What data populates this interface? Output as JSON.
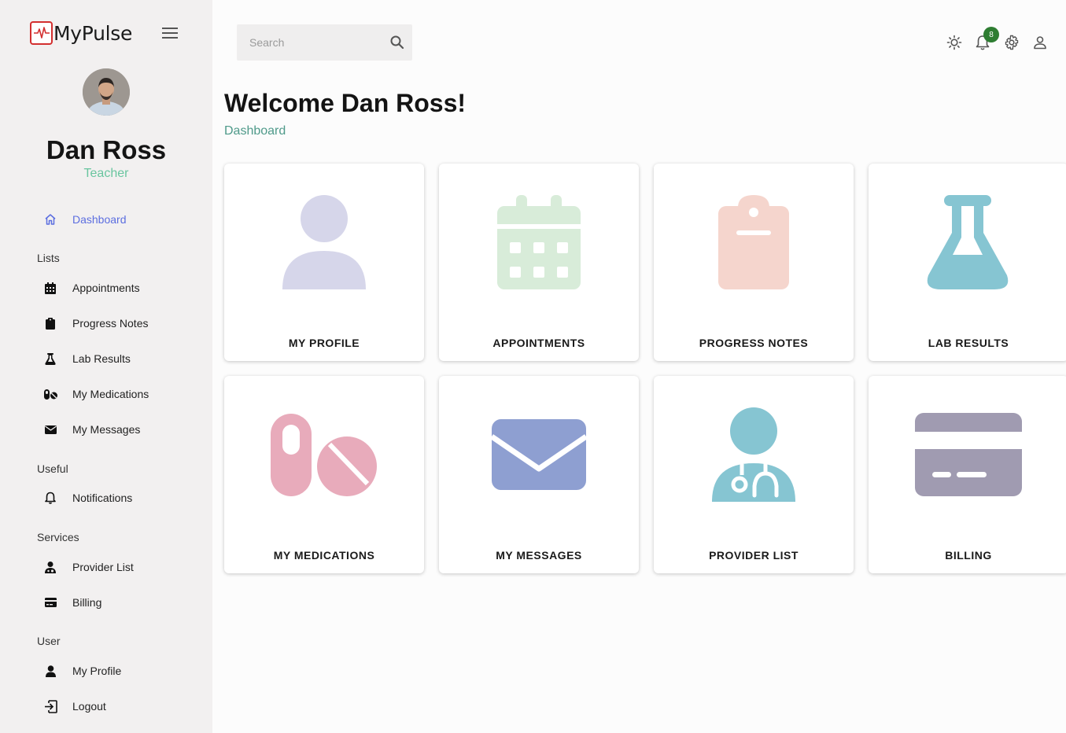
{
  "brand": {
    "name": "MyPulse"
  },
  "user": {
    "name": "Dan Ross",
    "role": "Teacher"
  },
  "sidebar": {
    "active": {
      "label": "Dashboard",
      "icon": "home-icon"
    },
    "sections": [
      {
        "title": "Lists",
        "items": [
          {
            "label": "Appointments",
            "icon": "calendar-icon"
          },
          {
            "label": "Progress Notes",
            "icon": "clipboard-icon"
          },
          {
            "label": "Lab Results",
            "icon": "flask-icon"
          },
          {
            "label": "My Medications",
            "icon": "pills-icon"
          },
          {
            "label": "My Messages",
            "icon": "envelope-icon"
          }
        ]
      },
      {
        "title": "Useful",
        "items": [
          {
            "label": "Notifications",
            "icon": "bell-icon"
          }
        ]
      },
      {
        "title": "Services",
        "items": [
          {
            "label": "Provider List",
            "icon": "doctor-icon"
          },
          {
            "label": "Billing",
            "icon": "credit-card-icon"
          }
        ]
      },
      {
        "title": "User",
        "items": [
          {
            "label": "My Profile",
            "icon": "person-icon"
          },
          {
            "label": "Logout",
            "icon": "logout-icon"
          }
        ]
      }
    ]
  },
  "topbar": {
    "search_placeholder": "Search",
    "notification_count": "8",
    "icons": [
      "sun-icon",
      "bell-icon",
      "gear-icon",
      "account-icon"
    ]
  },
  "main": {
    "welcome": "Welcome Dan Ross!",
    "breadcrumb": "Dashboard",
    "cards": [
      {
        "label": "MY PROFILE",
        "icon": "person-icon",
        "color": "#d6d6ea"
      },
      {
        "label": "APPOINTMENTS",
        "icon": "calendar-icon",
        "color": "#d8ecd9"
      },
      {
        "label": "PROGRESS NOTES",
        "icon": "clipboard-icon",
        "color": "#f5d5cd"
      },
      {
        "label": "LAB RESULTS",
        "icon": "flask-icon",
        "color": "#86c5d2"
      },
      {
        "label": "MY MEDICATIONS",
        "icon": "pills-icon",
        "color": "#e8abbb"
      },
      {
        "label": "MY MESSAGES",
        "icon": "envelope-icon",
        "color": "#8e9fd1"
      },
      {
        "label": "PROVIDER LIST",
        "icon": "doctor-icon",
        "color": "#86c5d2"
      },
      {
        "label": "BILLING",
        "icon": "credit-card-icon",
        "color": "#a09bb1"
      }
    ]
  },
  "colors": {
    "active_nav": "#5c6ee0",
    "role": "#69c59f",
    "breadcrumb": "#4f9a8a",
    "badge": "#2e7d32",
    "sidebar_bg": "#f2f0f0"
  }
}
